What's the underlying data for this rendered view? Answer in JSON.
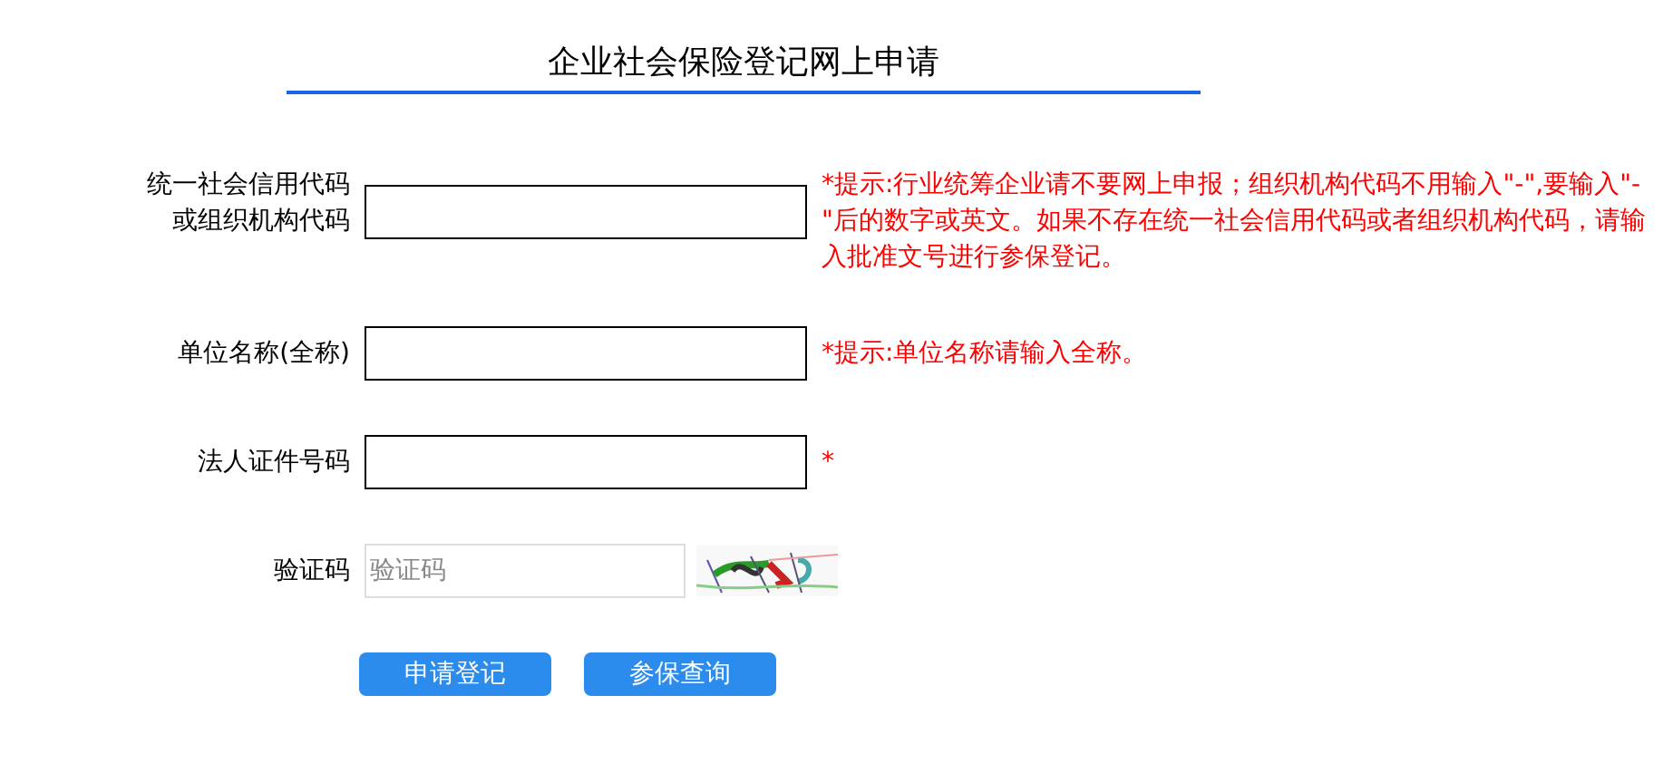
{
  "title": "企业社会保险登记网上申请",
  "fields": [
    {
      "kind": "text",
      "label": [
        "统一社会信用代码",
        "或组织机构代码"
      ],
      "hint": "*提示:行业统筹企业请不要网上申报；组织机构代码不用输入\"-\",要输入\"-\"后的数字或英文。如果不存在统一社会信用代码或者组织机构代码，请输入批准文号进行参保登记。"
    },
    {
      "kind": "text",
      "label": [
        "单位名称(全称)"
      ],
      "hint": "*提示:单位名称请输入全称。"
    },
    {
      "kind": "text",
      "label": [
        "法人证件号码"
      ],
      "hint": "*"
    },
    {
      "kind": "captcha",
      "label": [
        "验证码"
      ],
      "placeholder": "验证码"
    }
  ],
  "buttons": [
    "申请登记",
    "参保查询"
  ]
}
